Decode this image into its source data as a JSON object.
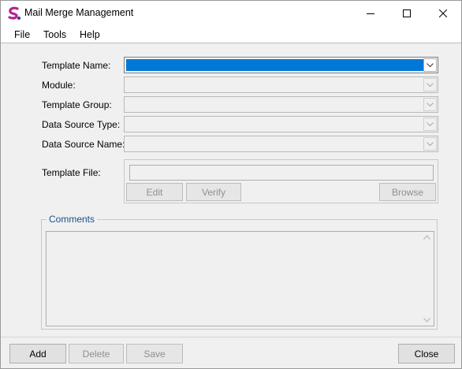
{
  "window": {
    "title": "Mail Merge Management",
    "controls": [
      "minimize-icon",
      "maximize-icon",
      "close-icon"
    ]
  },
  "menu": {
    "file": "File",
    "tools": "Tools",
    "help": "Help"
  },
  "form": {
    "template_name": {
      "label": "Template Name:",
      "value": ""
    },
    "module": {
      "label": "Module:",
      "value": ""
    },
    "template_group": {
      "label": "Template Group:",
      "value": ""
    },
    "data_source_type": {
      "label": "Data Source Type:",
      "value": ""
    },
    "data_source_name": {
      "label": "Data Source Name:",
      "value": ""
    },
    "template_file": {
      "label": "Template File:",
      "value": ""
    }
  },
  "file_buttons": {
    "edit": "Edit",
    "verify": "Verify",
    "browse": "Browse"
  },
  "comments": {
    "legend": "Comments",
    "value": ""
  },
  "footer": {
    "add": "Add",
    "delete": "Delete",
    "save": "Save",
    "close": "Close"
  },
  "colors": {
    "selection": "#0078d7",
    "legend_text": "#1c4e8e",
    "app_icon": "#b5238f"
  }
}
